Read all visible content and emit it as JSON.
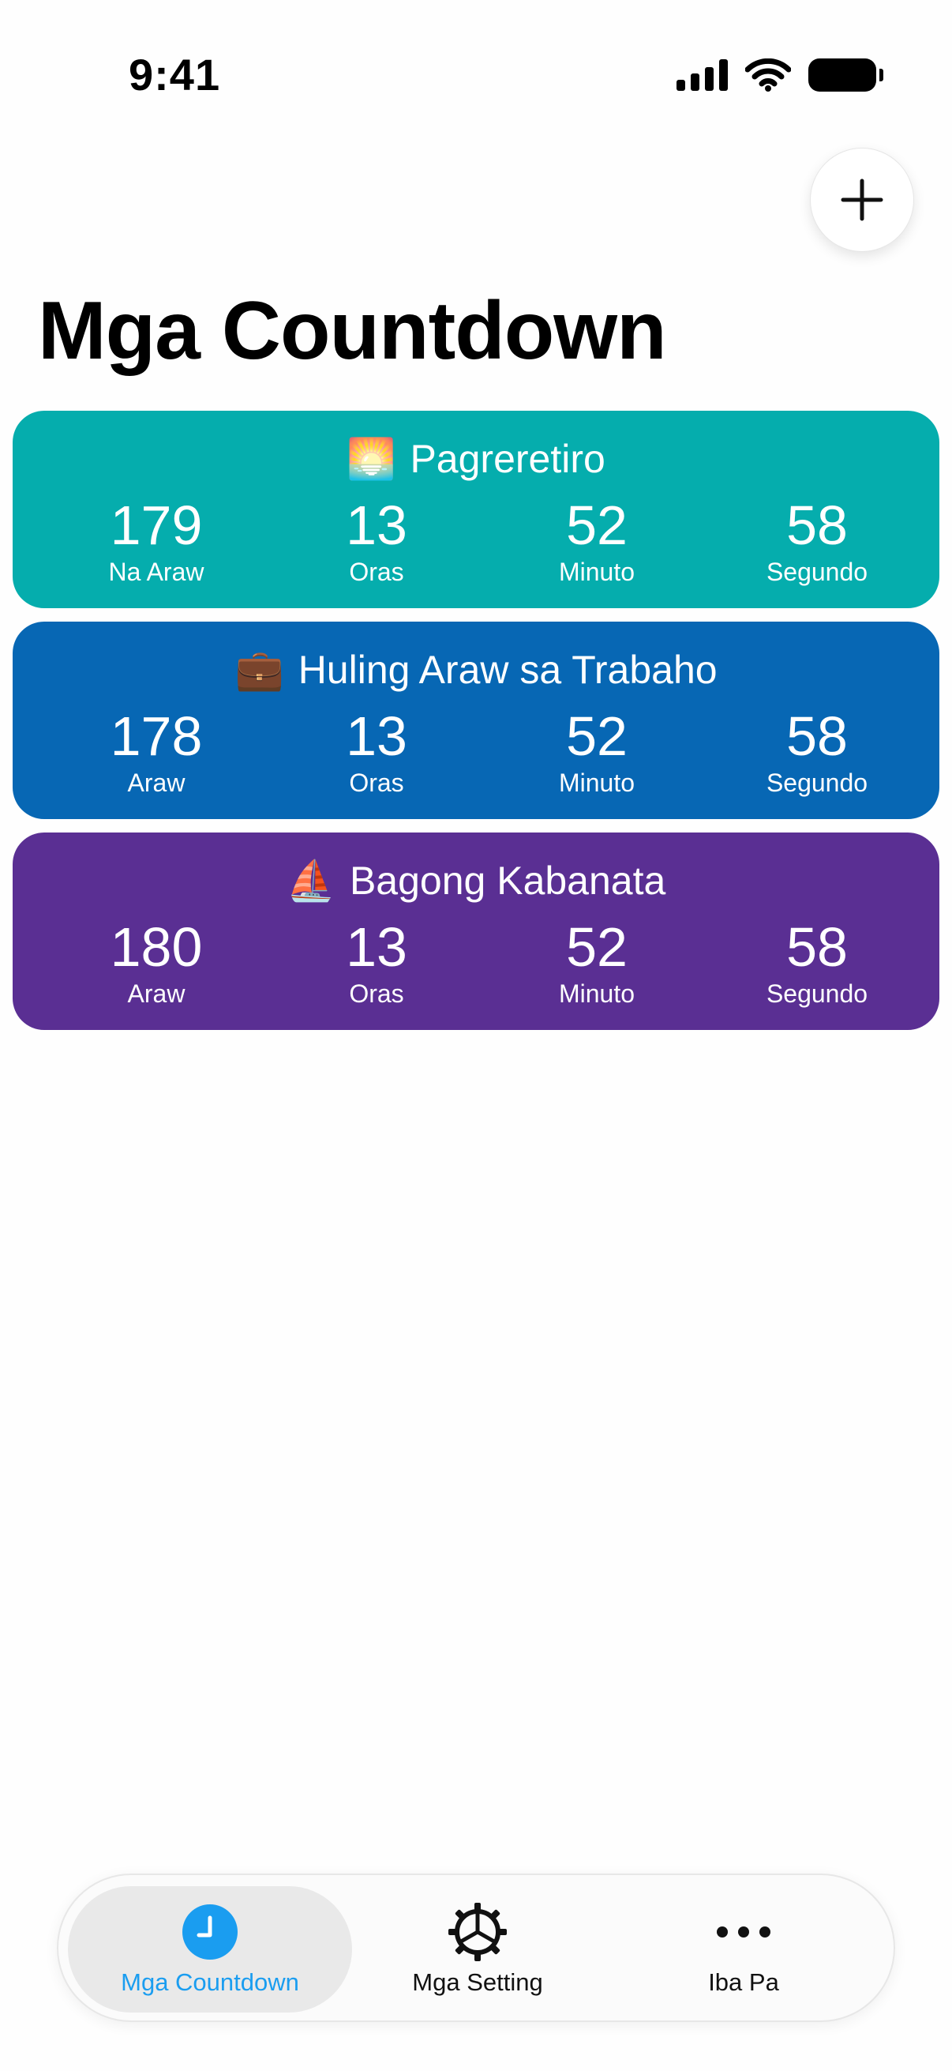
{
  "status_bar": {
    "time": "9:41"
  },
  "header": {
    "title": "Mga Countdown",
    "add_button_icon": "plus-icon"
  },
  "countdowns": [
    {
      "emoji": "🌅",
      "title": "Pagreretiro",
      "color": "#05ADAD",
      "units": [
        {
          "value": "179",
          "label": "Na Araw"
        },
        {
          "value": "13",
          "label": "Oras"
        },
        {
          "value": "52",
          "label": "Minuto"
        },
        {
          "value": "58",
          "label": "Segundo"
        }
      ]
    },
    {
      "emoji": "💼",
      "title": "Huling Araw sa Trabaho",
      "color": "#0767B4",
      "units": [
        {
          "value": "178",
          "label": "Araw"
        },
        {
          "value": "13",
          "label": "Oras"
        },
        {
          "value": "52",
          "label": "Minuto"
        },
        {
          "value": "58",
          "label": "Segundo"
        }
      ]
    },
    {
      "emoji": "⛵",
      "title": "Bagong Kabanata",
      "color": "#5A2F93",
      "units": [
        {
          "value": "180",
          "label": "Araw"
        },
        {
          "value": "13",
          "label": "Oras"
        },
        {
          "value": "52",
          "label": "Minuto"
        },
        {
          "value": "58",
          "label": "Segundo"
        }
      ]
    }
  ],
  "tab_bar": {
    "tabs": [
      {
        "label": "Mga Countdown",
        "icon": "clock-icon",
        "active": true
      },
      {
        "label": "Mga Setting",
        "icon": "gear-icon",
        "active": false
      },
      {
        "label": "Iba Pa",
        "icon": "ellipsis-icon",
        "active": false
      }
    ],
    "active_color": "#1A9DF0"
  }
}
